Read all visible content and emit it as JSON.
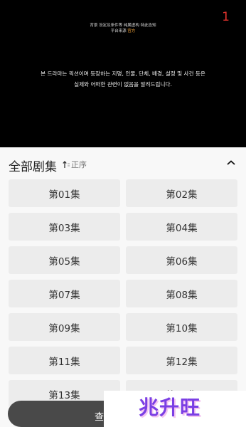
{
  "player": {
    "counter": "1",
    "notice_line1": "背景 设定及条件等 纯属虚构 特此告知",
    "notice_line2_prefix": "平台来源 ",
    "notice_line2_highlight": "官方",
    "disclaimer_line1": "본 드라마는 픽션이며 등장하는 지명, 인물, 단체, 배경, 설정 및 사건 등은",
    "disclaimer_line2": "실제와 어떠한 관련이 없음을 알려드립니다."
  },
  "episode_panel": {
    "title": "全部剧集",
    "sort_label": "正序",
    "episodes": [
      "第01集",
      "第02集",
      "第03集",
      "第04集",
      "第05集",
      "第06集",
      "第07集",
      "第08集",
      "第09集",
      "第10集",
      "第11集",
      "第12集",
      "第13集",
      "第14集"
    ]
  },
  "bottom": {
    "button_label": "查"
  },
  "watermark": {
    "text": "兆升旺"
  },
  "colors": {
    "counter": "#e0322d",
    "highlight": "#f2a33a",
    "panel_bg": "#f8f8f8",
    "episode_bg": "#ececec",
    "watermark": "#7b3fe4"
  }
}
